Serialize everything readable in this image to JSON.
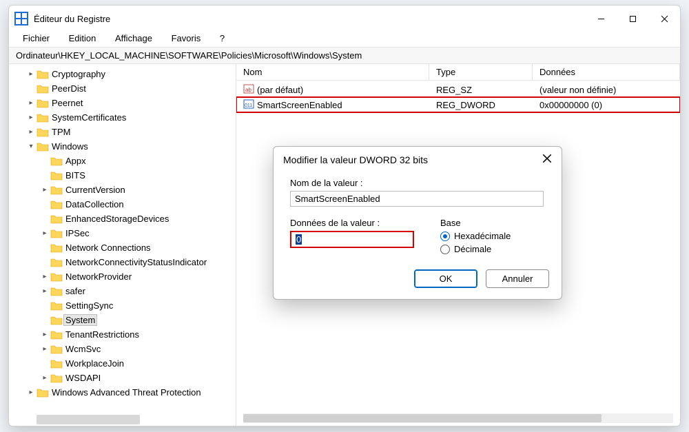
{
  "window": {
    "title": "Éditeur du Registre"
  },
  "menu": {
    "file": "Fichier",
    "edit": "Edition",
    "view": "Affichage",
    "favorites": "Favoris",
    "help": "?"
  },
  "address": {
    "path": "Ordinateur\\HKEY_LOCAL_MACHINE\\SOFTWARE\\Policies\\Microsoft\\Windows\\System"
  },
  "tree": {
    "items": [
      {
        "label": "Cryptography",
        "indent": 1,
        "expandable": true
      },
      {
        "label": "PeerDist",
        "indent": 1,
        "expandable": false
      },
      {
        "label": "Peernet",
        "indent": 1,
        "expandable": true
      },
      {
        "label": "SystemCertificates",
        "indent": 1,
        "expandable": true
      },
      {
        "label": "TPM",
        "indent": 1,
        "expandable": true
      },
      {
        "label": "Windows",
        "indent": 1,
        "expandable": true,
        "expanded": true
      },
      {
        "label": "Appx",
        "indent": 2,
        "expandable": false
      },
      {
        "label": "BITS",
        "indent": 2,
        "expandable": false
      },
      {
        "label": "CurrentVersion",
        "indent": 2,
        "expandable": true
      },
      {
        "label": "DataCollection",
        "indent": 2,
        "expandable": false
      },
      {
        "label": "EnhancedStorageDevices",
        "indent": 2,
        "expandable": false
      },
      {
        "label": "IPSec",
        "indent": 2,
        "expandable": true
      },
      {
        "label": "Network Connections",
        "indent": 2,
        "expandable": false
      },
      {
        "label": "NetworkConnectivityStatusIndicator",
        "indent": 2,
        "expandable": false
      },
      {
        "label": "NetworkProvider",
        "indent": 2,
        "expandable": true
      },
      {
        "label": "safer",
        "indent": 2,
        "expandable": true
      },
      {
        "label": "SettingSync",
        "indent": 2,
        "expandable": false
      },
      {
        "label": "System",
        "indent": 2,
        "expandable": false,
        "selected": true
      },
      {
        "label": "TenantRestrictions",
        "indent": 2,
        "expandable": true
      },
      {
        "label": "WcmSvc",
        "indent": 2,
        "expandable": true
      },
      {
        "label": "WorkplaceJoin",
        "indent": 2,
        "expandable": false
      },
      {
        "label": "WSDAPI",
        "indent": 2,
        "expandable": true
      },
      {
        "label": "Windows Advanced Threat Protection",
        "indent": 1,
        "expandable": true
      }
    ]
  },
  "list": {
    "columns": {
      "name": "Nom",
      "type": "Type",
      "data": "Données"
    },
    "rows": [
      {
        "icon": "sz",
        "name": "(par défaut)",
        "type": "REG_SZ",
        "data": "(valeur non définie)",
        "highlight": false
      },
      {
        "icon": "dw",
        "name": "SmartScreenEnabled",
        "type": "REG_DWORD",
        "data": "0x00000000 (0)",
        "highlight": true
      }
    ]
  },
  "dialog": {
    "title": "Modifier la valeur DWORD 32 bits",
    "name_label": "Nom de la valeur :",
    "name_value": "SmartScreenEnabled",
    "data_label": "Données de la valeur :",
    "data_value": "0",
    "base_label": "Base",
    "radio_hex": "Hexadécimale",
    "radio_dec": "Décimale",
    "ok": "OK",
    "cancel": "Annuler"
  }
}
